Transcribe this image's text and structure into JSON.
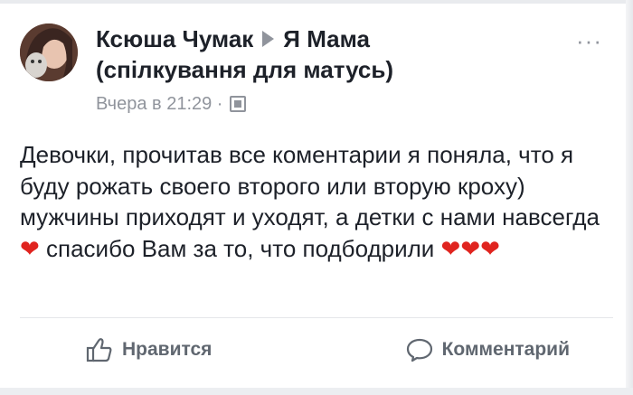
{
  "post": {
    "author": "Ксюша Чумак",
    "group_line1": "Я Мама",
    "group_line2": "(спілкування для матусь)",
    "timestamp": "Вчера в 21:29 ·",
    "text_parts": [
      "Девочки, прочитав все коментарии я поняла, что я буду рожать своего второго или вторую кроху) мужчины приходят и уходят, а детки с нами навсегда",
      "❤",
      " спасибо Вам за то, что подбодрили ",
      "❤❤❤"
    ]
  },
  "actions": {
    "like_label": "Нравится",
    "comment_label": "Комментарий"
  },
  "icons": {
    "more": "more-options-icon",
    "privacy": "privacy-icon",
    "like": "thumbs-up-icon",
    "comment": "comment-bubble-icon"
  },
  "colors": {
    "heart": "#e0241f",
    "secondary_text": "#90949c",
    "action_text": "#606770"
  }
}
